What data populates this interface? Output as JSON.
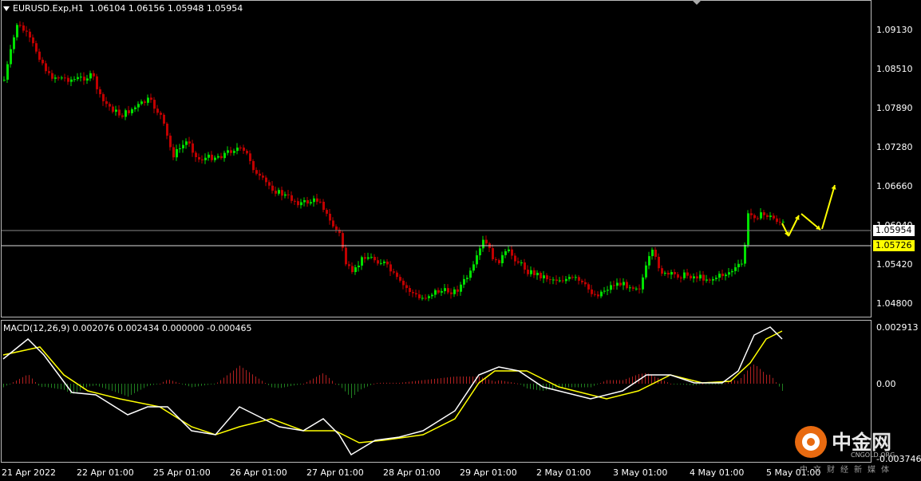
{
  "header": {
    "symbol": "EURUSD.Exp,H1",
    "quote": "1.06104 1.06156 1.05948 1.05954"
  },
  "price_axis": {
    "labels": [
      "1.09130",
      "1.08510",
      "1.07890",
      "1.07280",
      "1.06660",
      "1.06040",
      "1.05420",
      "1.04800"
    ],
    "current_price": "1.05954",
    "level_price": "1.05726"
  },
  "macd": {
    "label": "MACD(12,26,9) 0.002076 0.002434 0.000000 -0.000465",
    "axis_labels": [
      "0.002913",
      "0.00",
      "-0.003746"
    ]
  },
  "time_axis": {
    "labels": [
      "21 Apr 2022",
      "22 Apr 01:00",
      "25 Apr 01:00",
      "26 Apr 01:00",
      "27 Apr 01:00",
      "28 Apr 01:00",
      "29 Apr 01:00",
      "2 May 01:00",
      "3 May 01:00",
      "4 May 01:00",
      "5 May 01:00"
    ]
  },
  "watermark": {
    "name": "中金网",
    "domain": "CNGOLD.ORG",
    "tagline": "中文财经新媒体"
  },
  "colors": {
    "up": "#00e000",
    "down": "#c00000",
    "macd_main": "#ffffff",
    "macd_signal": "#ffff00",
    "forecast_arrow": "#ffff00",
    "level_tag": "#ffff00",
    "price_tag": "#ffffff"
  }
}
